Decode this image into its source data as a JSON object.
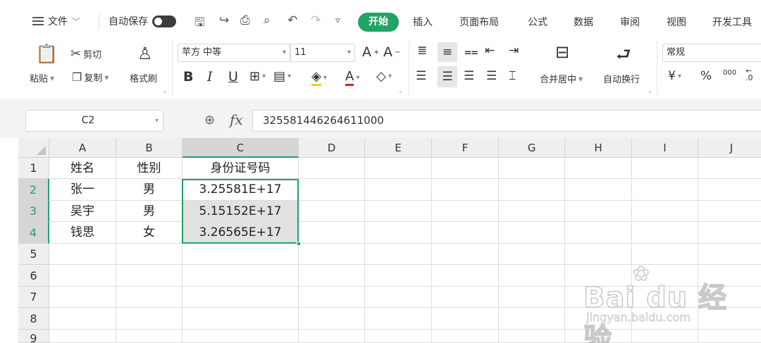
{
  "menu": {
    "file_label": "文件",
    "autosave_label": "自动保存",
    "tabs": [
      "开始",
      "插入",
      "页面布局",
      "公式",
      "数据",
      "审阅",
      "视图",
      "开发工具"
    ]
  },
  "ribbon": {
    "paste_label": "粘贴",
    "cut_label": "剪切",
    "copy_label": "复制",
    "format_painter_label": "格式刷",
    "font_name": "苹方 中等",
    "font_size": "11",
    "bold": "B",
    "italic": "I",
    "underline": "U",
    "merge_label": "合并居中",
    "wrap_label": "自动换行",
    "number_format": "常规",
    "currency_symbol": "¥",
    "percent_symbol": "%",
    "thousands_symbol": "000"
  },
  "formula_bar": {
    "name_box": "C2",
    "fx_label": "fx",
    "value": "325581446264611000"
  },
  "sheet": {
    "columns": [
      "A",
      "B",
      "C",
      "D",
      "E",
      "F",
      "G",
      "H",
      "I",
      "J"
    ],
    "rows": [
      "1",
      "2",
      "3",
      "4",
      "5",
      "6",
      "7",
      "8",
      "9"
    ],
    "cells": {
      "A1": "姓名",
      "B1": "性别",
      "C1": "身份证号码",
      "A2": "张一",
      "B2": "男",
      "C2": "3.25581E+17",
      "A3": "吴宇",
      "B3": "男",
      "C3": "5.15152E+17",
      "A4": "钱思",
      "B4": "女",
      "C4": "3.26565E+17"
    }
  },
  "watermark": {
    "logo_text": "Bai du 经验",
    "url": "jingyan.baidu.com"
  },
  "colors": {
    "accent": "#21a366",
    "selected_header": "#d6d6d6",
    "header_bg": "#efefef",
    "formula_bar_bg": "#f3f3f3"
  }
}
